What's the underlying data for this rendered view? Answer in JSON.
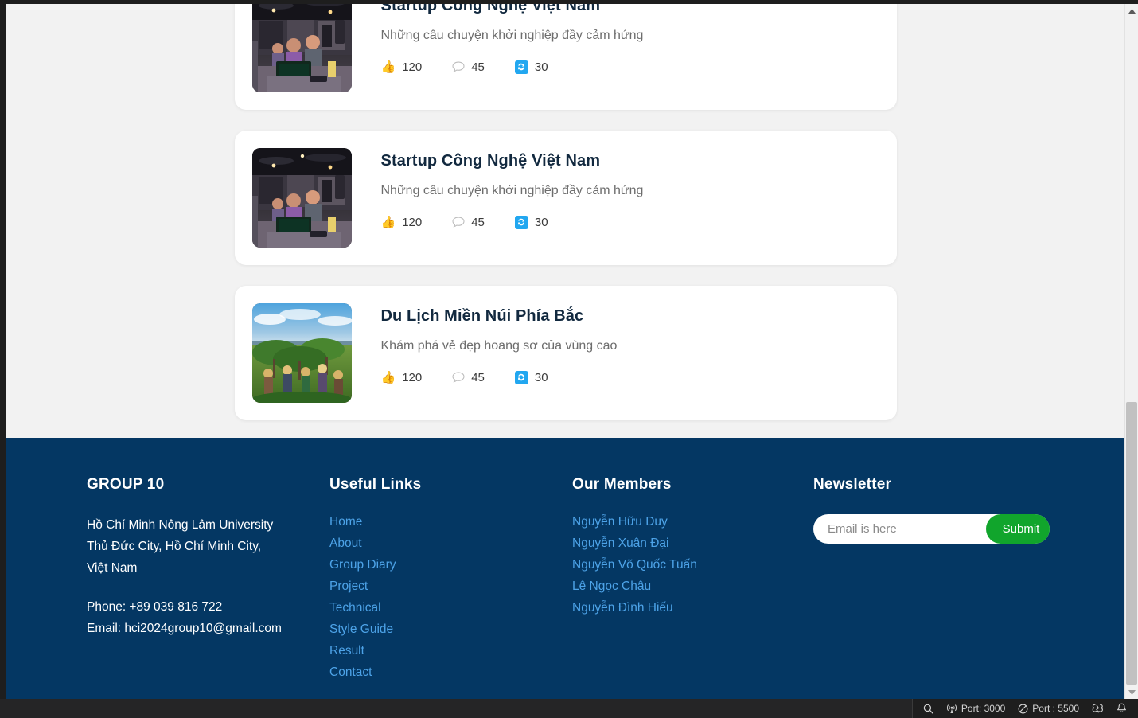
{
  "articles": [
    {
      "title": "Startup Công Nghệ Việt Nam",
      "description": "Những câu chuyện khởi nghiệp đầy cảm hứng",
      "image": "office-startup-team-photo",
      "likes": "120",
      "comments": "45",
      "reposts": "30"
    },
    {
      "title": "Startup Công Nghệ Việt Nam",
      "description": "Những câu chuyện khởi nghiệp đầy cảm hứng",
      "image": "office-startup-team-photo",
      "likes": "120",
      "comments": "45",
      "reposts": "30"
    },
    {
      "title": "Du Lịch Miền Núi Phía Bắc",
      "description": "Khám phá vẻ đẹp hoang sơ của vùng cao",
      "image": "northern-mountain-farmers-photo",
      "likes": "120",
      "comments": "45",
      "reposts": "30"
    }
  ],
  "stat_icons": {
    "like": "thumbs-up-icon",
    "comment": "speech-bubble-icon",
    "repost": "repost-icon"
  },
  "footer": {
    "brand": {
      "heading": "GROUP 10",
      "address_lines": [
        "Hồ Chí Minh Nông Lâm University",
        "Thủ Đức City, Hồ Chí Minh City,",
        "Việt Nam"
      ],
      "phone": "Phone: +89 039 816 722",
      "email": "Email: hci2024group10@gmail.com"
    },
    "useful_links": {
      "heading": "Useful Links",
      "items": [
        "Home",
        "About",
        "Group Diary",
        "Project",
        "Technical",
        "Style Guide",
        "Result",
        "Contact"
      ]
    },
    "members": {
      "heading": "Our Members",
      "items": [
        "Nguyễn Hữu Duy",
        "Nguyễn Xuân Đại",
        "Nguyễn Võ Quốc Tuấn",
        "Lê Ngọc Châu",
        "Nguyễn Đình Hiếu"
      ]
    },
    "newsletter": {
      "heading": "Newsletter",
      "placeholder": "Email is here",
      "value": "",
      "submit_label": "Submit"
    },
    "colors": {
      "background": "#043763",
      "link": "#4da3e8",
      "submit": "#11a52c"
    }
  },
  "status_bar": {
    "items": [
      {
        "icon": "search-icon",
        "label": ""
      },
      {
        "icon": "broadcast-icon",
        "label": "Port: 3000"
      },
      {
        "icon": "circle-slash-icon",
        "label": "Port : 5500"
      },
      {
        "icon": "remote-ports-icon",
        "label": ""
      },
      {
        "icon": "bell-icon",
        "label": ""
      }
    ]
  },
  "scrollbar": {
    "up_arrow": "chevron-up-icon",
    "down_arrow": "chevron-down-icon"
  }
}
